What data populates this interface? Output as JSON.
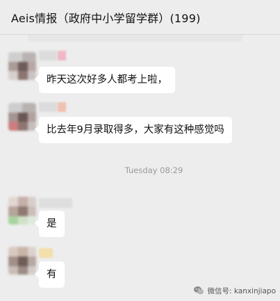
{
  "chat": {
    "title": "Aeis情报（政府中小学留学群）(199)"
  },
  "messages": [
    {
      "text": "昨天这次好多人都考上啦，"
    },
    {
      "text": "比去年9月录取得多，大家有这种感觉吗"
    },
    {
      "text": "是"
    },
    {
      "text": "有"
    }
  ],
  "timestamp": "Tuesday 08:29",
  "watermark": {
    "text": "微信号: kanxinjiapo"
  },
  "colors": {
    "background": "#ededed",
    "bubble": "#ffffff",
    "text": "#111111",
    "timestamp": "#9a9a9a"
  }
}
